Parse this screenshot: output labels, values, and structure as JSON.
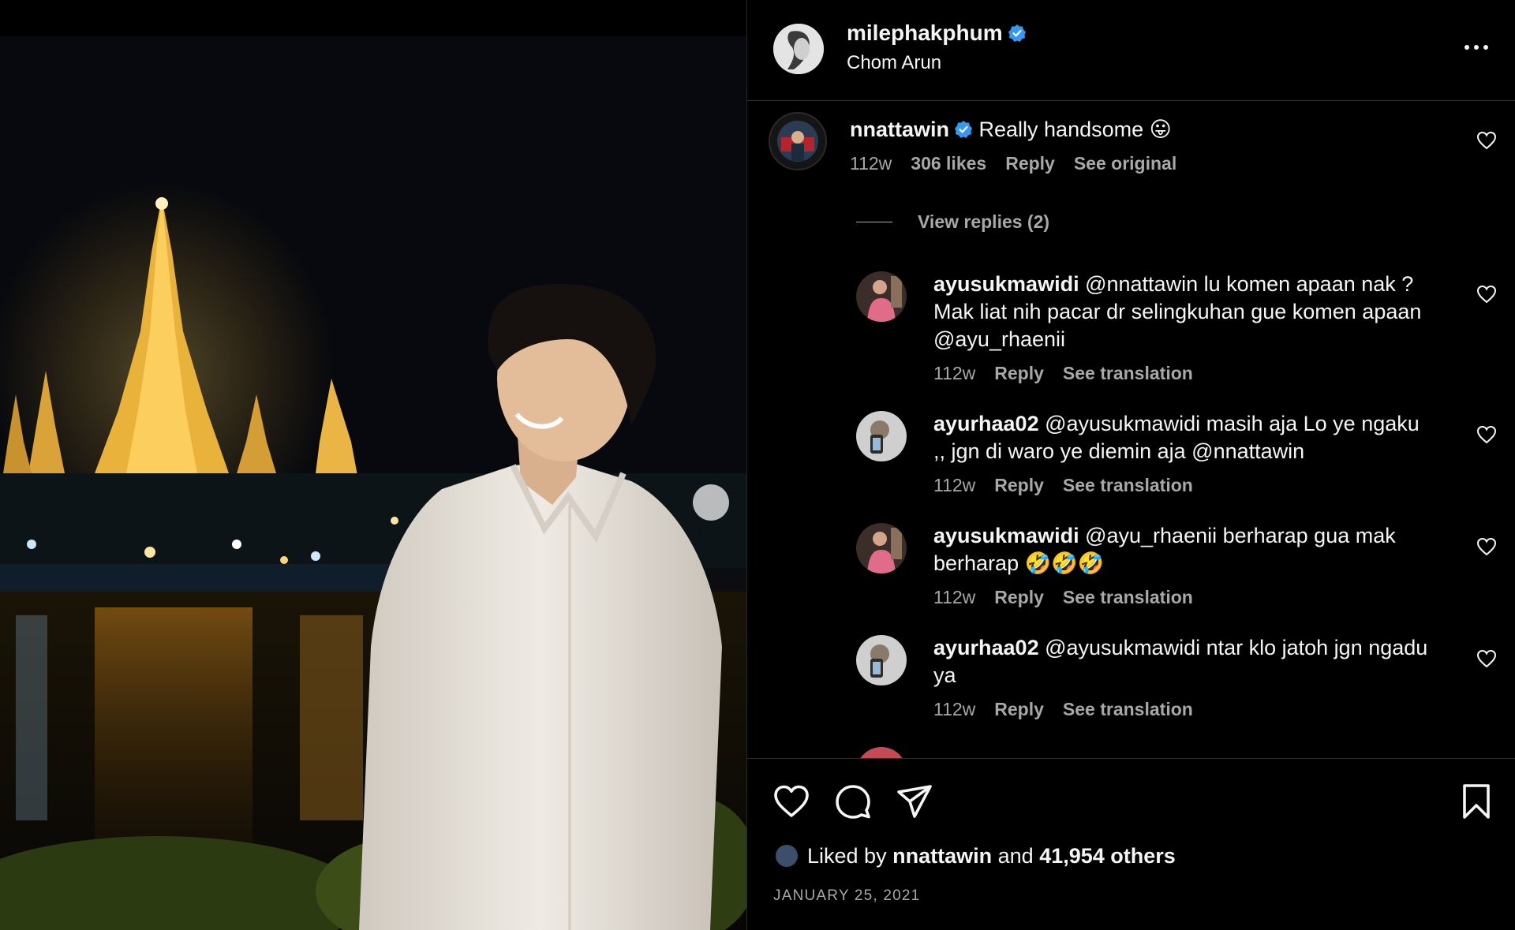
{
  "post": {
    "owner": "milephakphum",
    "location": "Chom Arun"
  },
  "icons": {
    "verified": "verified-badge-icon",
    "more": "more-options-icon",
    "next": "chevron-right-icon",
    "like": "heart-icon",
    "comment": "comment-bubble-icon",
    "share": "paper-plane-icon",
    "save": "bookmark-icon"
  },
  "colors": {
    "verified_blue": "#3897f0",
    "muted": "#a8a8a8",
    "text": "#f5f5f5"
  },
  "top_comment": {
    "user": "nnattawin",
    "text": "Really handsome 😛",
    "time": "112w",
    "likes": "306 likes",
    "reply": "Reply",
    "see": "See original"
  },
  "view_replies": "View replies (2)",
  "replies": [
    {
      "user": "ayusukmawidi",
      "text": "@nnattawin lu komen apaan nak ? Mak liat nih pacar dr selingkuhan gue komen apaan @ayu_rhaenii",
      "time": "112w",
      "reply": "Reply",
      "see": "See translation"
    },
    {
      "user": "ayurhaa02",
      "text": "@ayusukmawidi masih aja Lo ye ngaku ,, jgn di waro ye diemin aja @nnattawin",
      "time": "112w",
      "reply": "Reply",
      "see": "See translation"
    },
    {
      "user": "ayusukmawidi",
      "text": "@ayu_rhaenii berharap gua mak berharap 🤣🤣🤣",
      "time": "112w",
      "reply": "Reply",
      "see": "See translation"
    },
    {
      "user": "ayurhaa02",
      "text": "@ayusukmawidi ntar klo jatoh jgn ngadu ya",
      "time": "112w",
      "reply": "Reply",
      "see": "See translation"
    }
  ],
  "likes": {
    "prefix": "Liked by",
    "user": "nnattawin",
    "and": "and",
    "others": "41,954 others"
  },
  "date": "JANUARY 25, 2021"
}
